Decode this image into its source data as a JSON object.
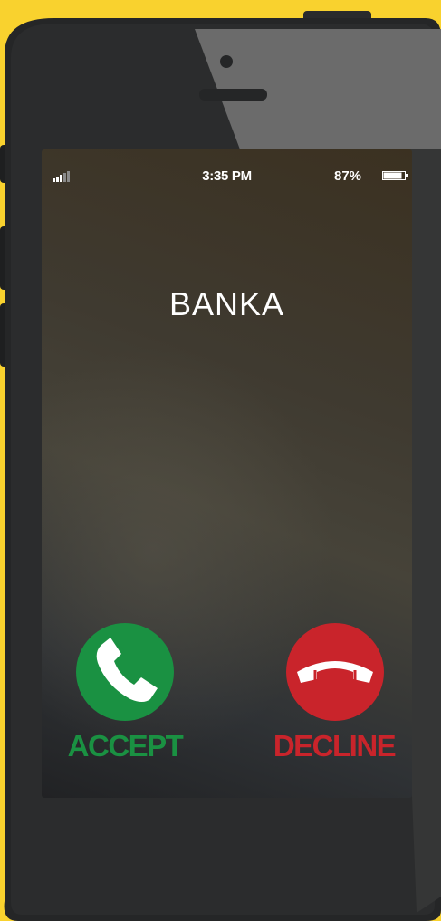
{
  "status_bar": {
    "signal_icon": "signal-bars-icon",
    "time": "3:35 PM",
    "battery_percent": "87%",
    "battery_icon": "battery-icon",
    "battery_level": 0.87
  },
  "call": {
    "caller_name": "BANKA",
    "accept_label": "ACCEPT",
    "decline_label": "DECLINE",
    "accept_icon": "phone-handset-icon",
    "decline_icon": "phone-hangup-icon"
  },
  "colors": {
    "background": "#F9D22E",
    "accept": "#1A9142",
    "decline": "#C9242B"
  }
}
